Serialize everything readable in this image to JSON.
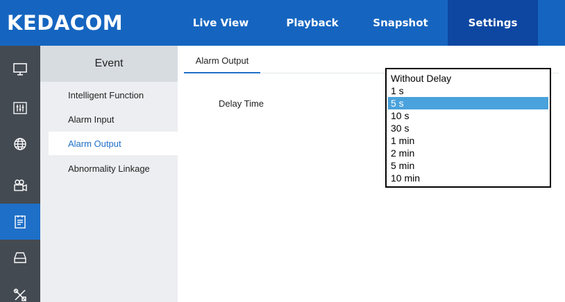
{
  "app": {
    "logo": "KEDACOM"
  },
  "nav": {
    "live_view": "Live View",
    "playback": "Playback",
    "snapshot": "Snapshot",
    "settings": "Settings",
    "active": "Settings"
  },
  "icon_rail": [
    {
      "icon": "monitor-icon",
      "active": false
    },
    {
      "icon": "sliders-icon",
      "active": false
    },
    {
      "icon": "network-globe-icon",
      "active": false
    },
    {
      "icon": "camera-icon",
      "active": false
    },
    {
      "icon": "event-list-icon",
      "active": true
    },
    {
      "icon": "storage-icon",
      "active": false
    },
    {
      "icon": "tools-icon",
      "active": false
    }
  ],
  "sidebar": {
    "title": "Event",
    "items": [
      {
        "label": "Intelligent Function"
      },
      {
        "label": "Alarm Input"
      },
      {
        "label": "Alarm Output"
      },
      {
        "label": "Abnormality Linkage"
      }
    ],
    "active": "Alarm Output"
  },
  "main": {
    "tab": "Alarm Output",
    "delay_label": "Delay Time"
  },
  "dropdown": {
    "options": [
      "Without Delay",
      "1 s",
      "5 s",
      "10 s",
      "30 s",
      "1 min",
      "2 min",
      "5 min",
      "10 min"
    ],
    "selected": "5 s"
  },
  "colors": {
    "header": "#1565c0",
    "accent": "#1e6fc8",
    "rail": "#444a52",
    "selected_option": "#4aa2dc"
  }
}
